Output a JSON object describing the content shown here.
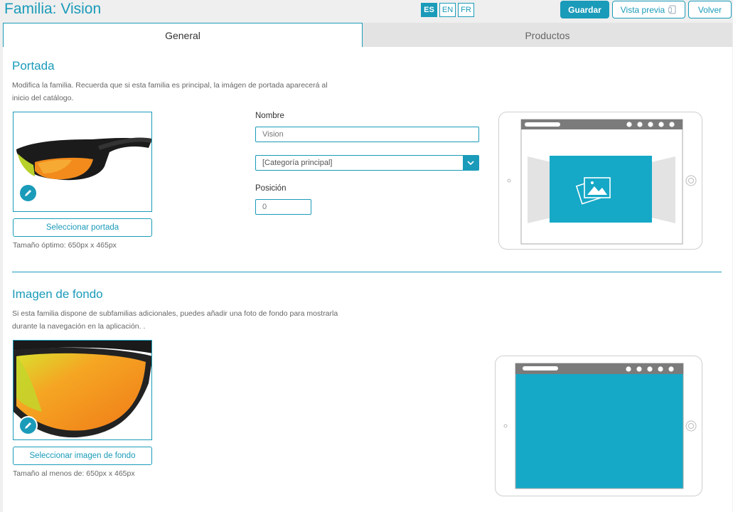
{
  "header": {
    "title": "Familia: Vision",
    "languages": [
      "ES",
      "EN",
      "FR"
    ],
    "save_label": "Guardar",
    "preview_label": "Vista previa",
    "back_label": "Volver"
  },
  "tabs": {
    "general": "General",
    "products": "Productos"
  },
  "cover": {
    "title": "Portada",
    "description": "Modifica la familia. Recuerda que si esta familia es principal, la imágen de portada aparecerá al inicio del catálogo.",
    "select_label": "Seleccionar portada",
    "hint": "Tamaño óptimo: 650px x 465px"
  },
  "form": {
    "name_label": "Nombre",
    "name_value": "Vision",
    "category_value": "[Categoría principal]",
    "position_label": "Posición",
    "position_value": "0"
  },
  "background": {
    "title": "Imagen de fondo",
    "description": "Si esta familia dispone de subfamilias adicionales, puedes añadir una foto de fondo para mostrarla durante la navegación en la aplicación. .",
    "select_label": "Seleccionar imagen de fondo",
    "hint": "Tamaño al menos de: 650px x 465px"
  },
  "colors": {
    "accent": "#1a9bb9",
    "lens_orange": "#f28b1c",
    "lens_yellow": "#c9d62a"
  }
}
